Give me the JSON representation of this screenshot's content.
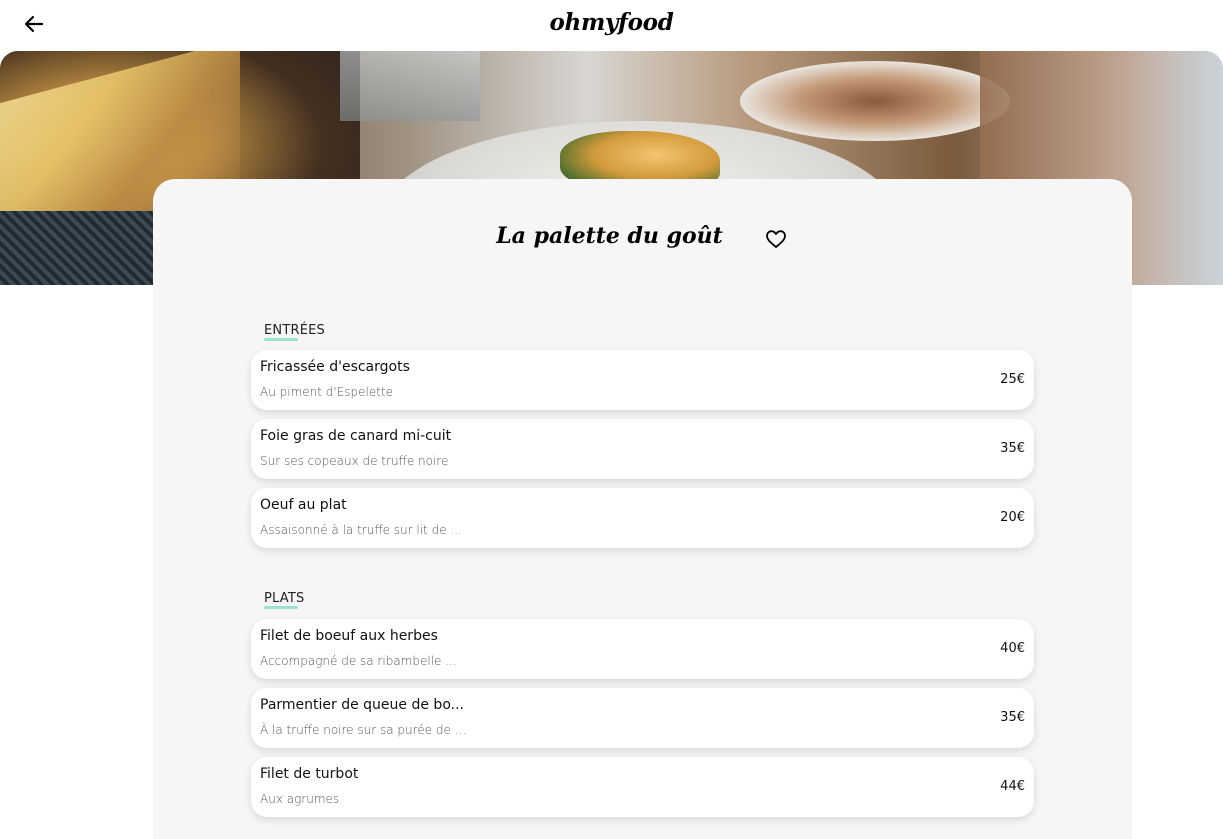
{
  "header": {
    "logo": "ohmyfood",
    "back_icon": "arrow-left-icon"
  },
  "hero": {
    "image": "restaurant-table-photo"
  },
  "restaurant": {
    "name": "La palette du goût",
    "favorite_icon": "heart-outline-icon"
  },
  "sections": [
    {
      "label": "ENTRÉES",
      "dishes": [
        {
          "name": "Fricassée d'escargots",
          "description": "Au piment d'Espelette",
          "price": "25€"
        },
        {
          "name": "Foie gras de canard mi-cuit",
          "description": "Sur ses copeaux de truffe noire",
          "price": "35€"
        },
        {
          "name": "Oeuf au plat",
          "description": "Assaisonné à la truffe sur lit de ...",
          "price": "20€"
        }
      ]
    },
    {
      "label": "PLATS",
      "dishes": [
        {
          "name": "Filet de boeuf aux herbes",
          "description": "Accompagné de sa ribambelle ...",
          "price": "40€"
        },
        {
          "name": "Parmentier de queue de bo...",
          "description": "À la truffe noire sur sa purée de ...",
          "price": "35€"
        },
        {
          "name": "Filet de turbot",
          "description": "Aux agrumes",
          "price": "44€"
        }
      ]
    }
  ],
  "colors": {
    "accent": "#99e2d0",
    "panel": "#f6f6f6"
  }
}
